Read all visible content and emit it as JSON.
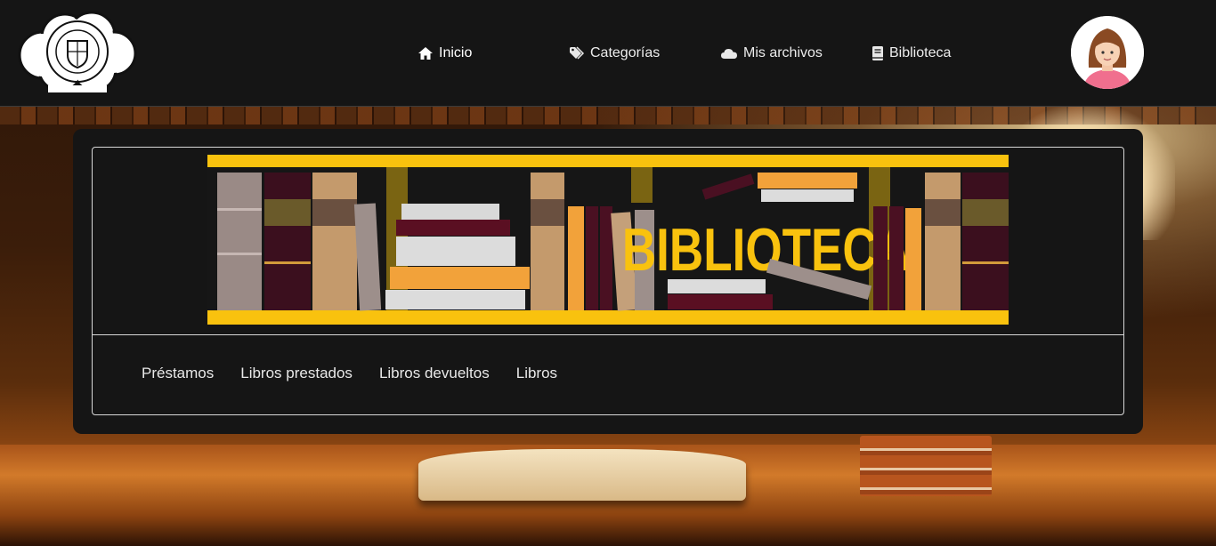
{
  "nav": {
    "items": [
      {
        "label": "Inicio",
        "icon": "home-icon"
      },
      {
        "label": "Categorías",
        "icon": "tags-icon"
      },
      {
        "label": "Mis archivos",
        "icon": "cloud-icon"
      },
      {
        "label": "Biblioteca",
        "icon": "book-icon"
      }
    ]
  },
  "logo": {
    "top_text": "ROBERTO ARTURO RIVERA RAMOS",
    "bottom_text": "KIMBILA, IZAMAL"
  },
  "banner": {
    "title": "BIBLIOTECA",
    "accent_color": "#f9c20e"
  },
  "tabs": [
    "Préstamos",
    "Libros prestados",
    "Libros devueltos",
    "Libros"
  ],
  "colors": {
    "navbar_bg": "#151515",
    "panel_bg": "#151515",
    "text": "#ececec"
  }
}
